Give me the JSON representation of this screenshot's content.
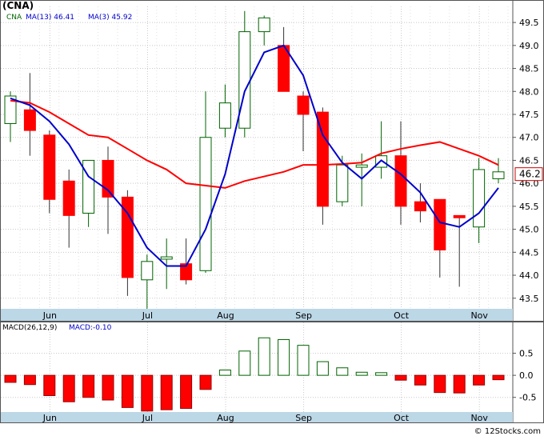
{
  "colors": {
    "up": "#006400",
    "down": "#ff0000",
    "ma13": "#ff0000",
    "ma3": "#0000cc",
    "axis_band": "#bcd7e6",
    "grid": "#c8c8c8",
    "border": "#555555",
    "price_tag_border": "#cc0000"
  },
  "chart_data": [
    {
      "type": "candlestick",
      "title": "(CNA)",
      "legend": [
        {
          "label": "CNA",
          "color": "#006400"
        },
        {
          "label": "MA(13)",
          "value": "46.41",
          "color": "#0000cc"
        },
        {
          "label": "MA(3)",
          "value": "45.92",
          "color": "#0000cc"
        }
      ],
      "y_ticks": [
        "43.5",
        "44.0",
        "44.5",
        "45.0",
        "45.5",
        "46.0",
        "46.5",
        "47.0",
        "47.5",
        "48.0",
        "48.5",
        "49.0",
        "49.5"
      ],
      "ylim": [
        43.2,
        49.85
      ],
      "x_labels": [
        "Jun",
        "Jul",
        "Aug",
        "Sep",
        "Oct",
        "Nov"
      ],
      "x_label_index": [
        1,
        6,
        10,
        14,
        19,
        23
      ],
      "last_price": "46.2",
      "candles": [
        {
          "o": 47.3,
          "h": 48.0,
          "l": 46.9,
          "c": 47.9
        },
        {
          "o": 47.6,
          "h": 48.4,
          "l": 46.6,
          "c": 47.15
        },
        {
          "o": 47.05,
          "h": 47.15,
          "l": 45.35,
          "c": 45.65
        },
        {
          "o": 46.05,
          "h": 46.3,
          "l": 44.6,
          "c": 45.3
        },
        {
          "o": 45.35,
          "h": 46.5,
          "l": 45.05,
          "c": 46.5
        },
        {
          "o": 46.5,
          "h": 46.8,
          "l": 44.9,
          "c": 45.7
        },
        {
          "o": 45.7,
          "h": 45.85,
          "l": 43.55,
          "c": 43.95
        },
        {
          "o": 43.9,
          "h": 44.45,
          "l": 43.25,
          "c": 44.3
        },
        {
          "o": 44.35,
          "h": 44.8,
          "l": 43.7,
          "c": 44.4
        },
        {
          "o": 44.25,
          "h": 44.8,
          "l": 43.8,
          "c": 43.9
        },
        {
          "o": 44.1,
          "h": 48.0,
          "l": 44.05,
          "c": 47.0
        },
        {
          "o": 47.2,
          "h": 48.15,
          "l": 47.0,
          "c": 47.75
        },
        {
          "o": 47.2,
          "h": 49.75,
          "l": 47.0,
          "c": 49.3
        },
        {
          "o": 49.3,
          "h": 49.65,
          "l": 49.0,
          "c": 49.6
        },
        {
          "o": 49.0,
          "h": 49.4,
          "l": 48.0,
          "c": 48.0
        },
        {
          "o": 47.9,
          "h": 48.0,
          "l": 46.7,
          "c": 47.5
        },
        {
          "o": 47.55,
          "h": 47.65,
          "l": 45.1,
          "c": 45.5
        },
        {
          "o": 45.6,
          "h": 46.6,
          "l": 45.5,
          "c": 46.4
        },
        {
          "o": 46.35,
          "h": 46.65,
          "l": 45.5,
          "c": 46.4
        },
        {
          "o": 46.35,
          "h": 47.35,
          "l": 46.1,
          "c": 46.6
        },
        {
          "o": 46.6,
          "h": 47.35,
          "l": 45.1,
          "c": 45.5
        },
        {
          "o": 45.6,
          "h": 46.0,
          "l": 45.15,
          "c": 45.4
        },
        {
          "o": 45.65,
          "h": 45.65,
          "l": 43.95,
          "c": 44.55
        },
        {
          "o": 45.3,
          "h": 45.3,
          "l": 43.75,
          "c": 45.25
        },
        {
          "o": 45.05,
          "h": 46.55,
          "l": 44.7,
          "c": 46.3
        },
        {
          "o": 46.1,
          "h": 46.55,
          "l": 46.0,
          "c": 46.25
        }
      ],
      "ma13_line": [
        {
          "i": 0,
          "v": 47.8
        },
        {
          "i": 1,
          "v": 47.75
        },
        {
          "i": 2,
          "v": 47.55
        },
        {
          "i": 3,
          "v": 47.3
        },
        {
          "i": 4,
          "v": 47.05
        },
        {
          "i": 5,
          "v": 47.0
        },
        {
          "i": 6,
          "v": 46.75
        },
        {
          "i": 7,
          "v": 46.5
        },
        {
          "i": 8,
          "v": 46.3
        },
        {
          "i": 9,
          "v": 46.0
        },
        {
          "i": 10,
          "v": 45.95
        },
        {
          "i": 11,
          "v": 45.9
        },
        {
          "i": 12,
          "v": 46.05
        },
        {
          "i": 13,
          "v": 46.15
        },
        {
          "i": 14,
          "v": 46.25
        },
        {
          "i": 15,
          "v": 46.4
        },
        {
          "i": 16,
          "v": 46.4
        },
        {
          "i": 17,
          "v": 46.42
        },
        {
          "i": 18,
          "v": 46.45
        },
        {
          "i": 19,
          "v": 46.65
        },
        {
          "i": 20,
          "v": 46.75
        },
        {
          "i": 21,
          "v": 46.83
        },
        {
          "i": 22,
          "v": 46.9
        },
        {
          "i": 23,
          "v": 46.75
        },
        {
          "i": 24,
          "v": 46.6
        },
        {
          "i": 25,
          "v": 46.4
        }
      ],
      "ma3_line": [
        {
          "i": 0,
          "v": 47.85
        },
        {
          "i": 1,
          "v": 47.7
        },
        {
          "i": 2,
          "v": 47.35
        },
        {
          "i": 3,
          "v": 46.85
        },
        {
          "i": 4,
          "v": 46.15
        },
        {
          "i": 5,
          "v": 45.85
        },
        {
          "i": 6,
          "v": 45.35
        },
        {
          "i": 7,
          "v": 44.6
        },
        {
          "i": 8,
          "v": 44.2
        },
        {
          "i": 9,
          "v": 44.2
        },
        {
          "i": 10,
          "v": 45.0
        },
        {
          "i": 11,
          "v": 46.2
        },
        {
          "i": 12,
          "v": 48.0
        },
        {
          "i": 13,
          "v": 48.85
        },
        {
          "i": 14,
          "v": 49.0
        },
        {
          "i": 15,
          "v": 48.35
        },
        {
          "i": 16,
          "v": 47.05
        },
        {
          "i": 17,
          "v": 46.45
        },
        {
          "i": 18,
          "v": 46.1
        },
        {
          "i": 19,
          "v": 46.5
        },
        {
          "i": 20,
          "v": 46.2
        },
        {
          "i": 21,
          "v": 45.8
        },
        {
          "i": 22,
          "v": 45.15
        },
        {
          "i": 23,
          "v": 45.05
        },
        {
          "i": 24,
          "v": 45.35
        },
        {
          "i": 25,
          "v": 45.9
        }
      ]
    },
    {
      "type": "bar",
      "title": "MACD(26,12,9)",
      "subtitle": "MACD:-0.10",
      "y_ticks": [
        "-0.5",
        "0.0",
        "0.5"
      ],
      "y_tick_values": [
        -0.5,
        0.0,
        0.5
      ],
      "ylim": [
        -0.85,
        1.0
      ],
      "x_labels": [
        "Jun",
        "Jul",
        "Aug",
        "Sep",
        "Oct",
        "Nov"
      ],
      "values": [
        -0.16,
        -0.21,
        -0.46,
        -0.6,
        -0.5,
        -0.56,
        -0.73,
        -0.81,
        -0.78,
        -0.75,
        -0.32,
        0.12,
        0.55,
        0.85,
        0.81,
        0.68,
        0.31,
        0.17,
        0.07,
        0.06,
        -0.11,
        -0.22,
        -0.39,
        -0.4,
        -0.22,
        -0.1
      ]
    }
  ]
}
